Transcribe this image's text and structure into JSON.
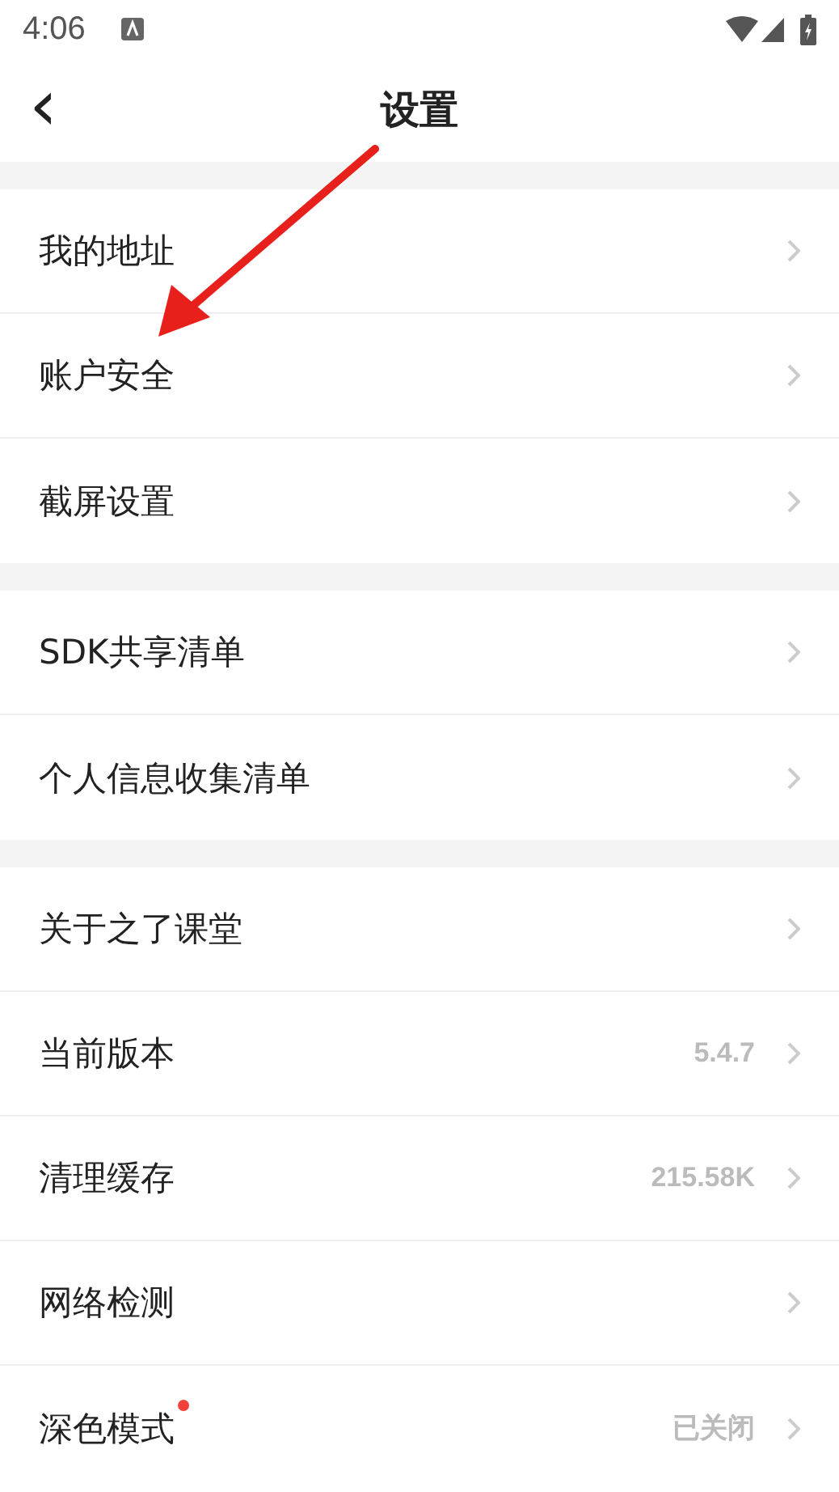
{
  "status_bar": {
    "time": "4:06"
  },
  "header": {
    "back": "‹",
    "title": "设置"
  },
  "groups": [
    {
      "items": [
        {
          "label": "我的地址",
          "new_dot": false
        },
        {
          "label": "账户安全",
          "new_dot": false
        },
        {
          "label": "截屏设置",
          "new_dot": false
        }
      ]
    },
    {
      "items": [
        {
          "label": "SDK共享清单",
          "new_dot": false
        },
        {
          "label": "个人信息收集清单",
          "new_dot": false
        }
      ]
    },
    {
      "items": [
        {
          "label": "关于之了课堂",
          "new_dot": false
        },
        {
          "label": "当前版本",
          "value": "5.4.7",
          "new_dot": false
        },
        {
          "label": "清理缓存",
          "value": "215.58K",
          "new_dot": false
        },
        {
          "label": "网络检测",
          "new_dot": false
        },
        {
          "label": "深色模式",
          "value": "已关闭",
          "new_dot": true
        }
      ]
    }
  ]
}
